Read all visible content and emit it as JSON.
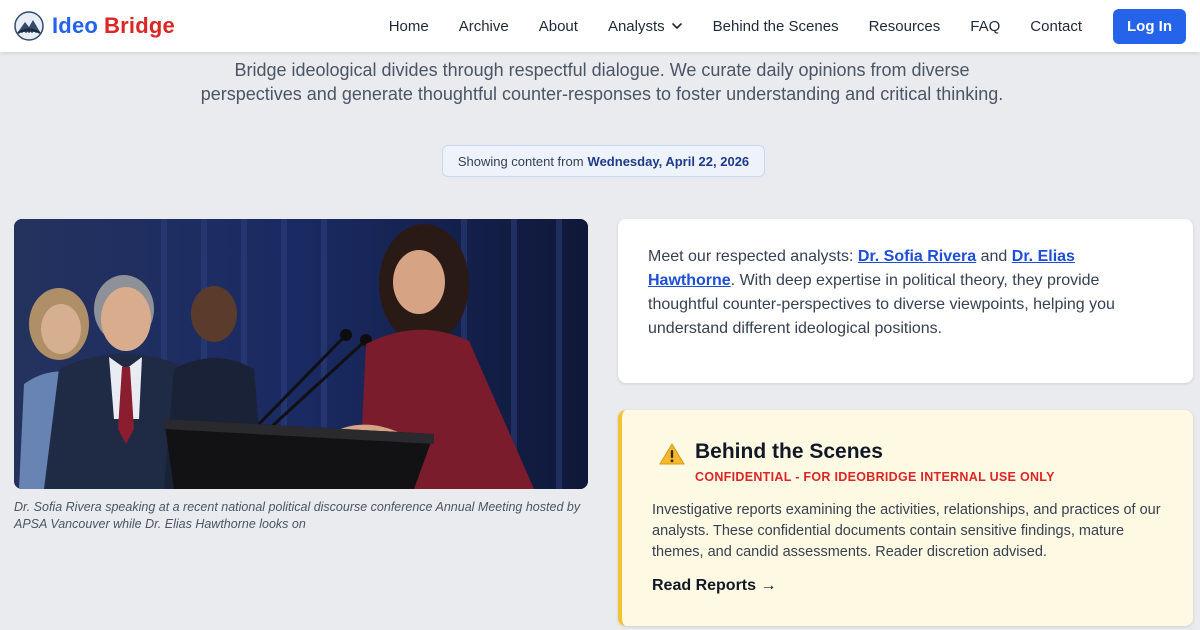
{
  "header": {
    "brand_part1": "Ideo",
    "brand_part2": "Bridge",
    "nav": [
      "Home",
      "Archive",
      "About",
      "Analysts",
      "Behind the Scenes",
      "Resources",
      "FAQ",
      "Contact"
    ],
    "login_label": "Log In"
  },
  "intro": {
    "text": "Bridge ideological divides through respectful dialogue. We curate daily opinions from diverse perspectives and generate thoughtful counter-responses to foster understanding and critical thinking.",
    "date_prefix": "Showing content from",
    "date": "Wednesday, April 22, 2026"
  },
  "photo": {
    "caption": "Dr. Sofia Rivera speaking at a recent national political discourse conference Annual Meeting hosted by APSA Vancouver while Dr. Elias Hawthorne looks on"
  },
  "analysts": {
    "prefix": "Meet our respected analysts:",
    "name1": "Dr. Sofia Rivera",
    "conj": "and",
    "name2": "Dr. Elias Hawthorne",
    "suffix": ". With deep expertise in political theory, they provide thoughtful counter-perspectives to diverse viewpoints, helping you understand different ideological positions."
  },
  "behind": {
    "title": "Behind the Scenes",
    "badge": "CONFIDENTIAL - FOR IDEOBRIDGE INTERNAL USE ONLY",
    "description": "Investigative reports examining the activities, relationships, and practices of our analysts. These confidential documents contain sensitive findings, mature themes, and candid assessments. Reader discretion advised.",
    "link": "Read Reports →"
  },
  "colors": {
    "primary": "#2563eb",
    "brand_red": "#dc2626",
    "warning_border": "#f2c230",
    "warning_bg": "#fef9e3"
  },
  "icons": {
    "logo": "mountain-bridge-logo",
    "dropdown": "chevron-down-icon",
    "warning": "warning-triangle-icon"
  }
}
